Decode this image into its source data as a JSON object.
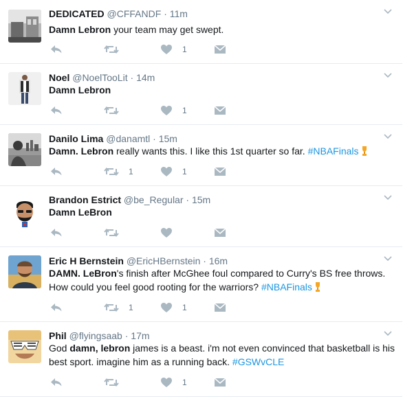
{
  "colors": {
    "link": "#1b95e0",
    "icon": "#aab8c2",
    "meta": "#657786",
    "text": "#14171a",
    "border": "#e6ecf0"
  },
  "tweets": [
    {
      "name": "DEDICATED",
      "handle": "@CFFANDF",
      "time": "11m",
      "avatar": "building-interior-avatar",
      "text_parts": [
        {
          "t": "Damn Lebron",
          "style": "bold"
        },
        {
          "t": " your team may get swept.",
          "style": "plain"
        }
      ],
      "retweets": "",
      "likes": "1"
    },
    {
      "name": "Noel",
      "handle": "@NoelTooLit",
      "time": "14m",
      "avatar": "standing-person-avatar",
      "text_parts": [
        {
          "t": "Damn Lebron",
          "style": "bold"
        }
      ],
      "retweets": "",
      "likes": "1"
    },
    {
      "name": "Danilo Lima",
      "handle": "@danamtl",
      "time": "15m",
      "avatar": "person-city-avatar",
      "text_parts": [
        {
          "t": "Damn. Lebron",
          "style": "bold"
        },
        {
          "t": " really wants this. I like this 1st quarter so far. ",
          "style": "plain"
        },
        {
          "t": "#NBAFinals",
          "style": "hashtag"
        }
      ],
      "trophy": true,
      "retweets": "1",
      "likes": "1"
    },
    {
      "name": "Brandon Estrict",
      "handle": "@be_Regular",
      "time": "15m",
      "avatar": "cartoon-face-avatar",
      "text_parts": [
        {
          "t": "Damn LeBron",
          "style": "bold"
        }
      ],
      "retweets": "",
      "likes": ""
    },
    {
      "name": "Eric H Bernstein",
      "handle": "@EricHBernstein",
      "time": "16m",
      "avatar": "man-outdoors-avatar",
      "text_parts": [
        {
          "t": "DAMN. LeBron",
          "style": "bold"
        },
        {
          "t": "'s finish after McGhee foul compared to Curry's BS free throws. How could you feel good rooting for the warriors? ",
          "style": "plain"
        },
        {
          "t": "#NBAFinals",
          "style": "hashtag"
        }
      ],
      "trophy": true,
      "retweets": "1",
      "likes": "1"
    },
    {
      "name": "Phil",
      "handle": "@flyingsaab",
      "time": "17m",
      "avatar": "sunglasses-avatar",
      "text_parts": [
        {
          "t": "God ",
          "style": "plain"
        },
        {
          "t": "damn, lebron",
          "style": "bold"
        },
        {
          "t": " james is a beast. i'm not even convinced that basketball is his best sport. imagine him as a running back. ",
          "style": "plain"
        },
        {
          "t": "#GSWvCLE",
          "style": "hashtag"
        }
      ],
      "retweets": "",
      "likes": "1"
    }
  ]
}
